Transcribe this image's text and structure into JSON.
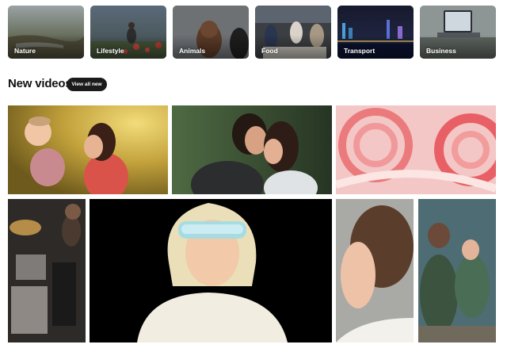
{
  "categories": [
    {
      "label": "Nature"
    },
    {
      "label": "Lifestyle"
    },
    {
      "label": "Animals"
    },
    {
      "label": "Food"
    },
    {
      "label": "Transport"
    },
    {
      "label": "Business"
    }
  ],
  "new_videos": {
    "title": "New videos",
    "view_all_label": "View all new"
  }
}
